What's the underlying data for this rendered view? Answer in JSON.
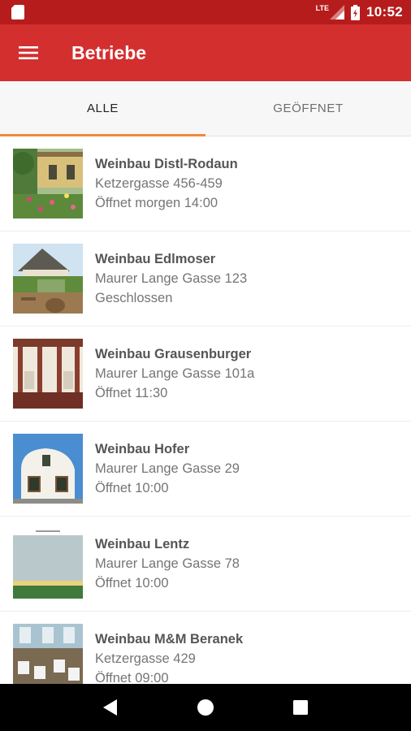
{
  "status_bar": {
    "network": "LTE",
    "time": "10:52",
    "icons": [
      "sd-card-icon",
      "signal-icon",
      "battery-charging-icon"
    ]
  },
  "app_bar": {
    "title": "Betriebe",
    "menu_icon": "hamburger-menu-icon"
  },
  "tabs": [
    {
      "label": "ALLE",
      "active": true
    },
    {
      "label": "GEÖFFNET",
      "active": false
    }
  ],
  "tab_indicator_color": "#ef8a3c",
  "colors": {
    "status_bar": "#b71c1c",
    "app_bar": "#d32f2f"
  },
  "businesses": [
    {
      "name": "Weinbau Distl-Rodaun",
      "address": "Ketzergasse 456-459",
      "status": "Öffnet morgen 14:00"
    },
    {
      "name": "Weinbau Edlmoser",
      "address": "Maurer Lange Gasse 123",
      "status": "Geschlossen"
    },
    {
      "name": "Weinbau Grausenburger",
      "address": "Maurer Lange Gasse 101a",
      "status": "Öffnet 11:30"
    },
    {
      "name": "Weinbau Hofer",
      "address": "Maurer Lange Gasse 29",
      "status": "Öffnet 10:00"
    },
    {
      "name": "Weinbau Lentz",
      "address": "Maurer Lange Gasse 78",
      "status": "Öffnet 10:00"
    },
    {
      "name": "Weinbau M&M Beranek",
      "address": "Ketzergasse 429",
      "status": "Öffnet 09:00"
    }
  ],
  "nav_bar": {
    "buttons": [
      "back-icon",
      "home-icon",
      "recents-icon"
    ]
  }
}
